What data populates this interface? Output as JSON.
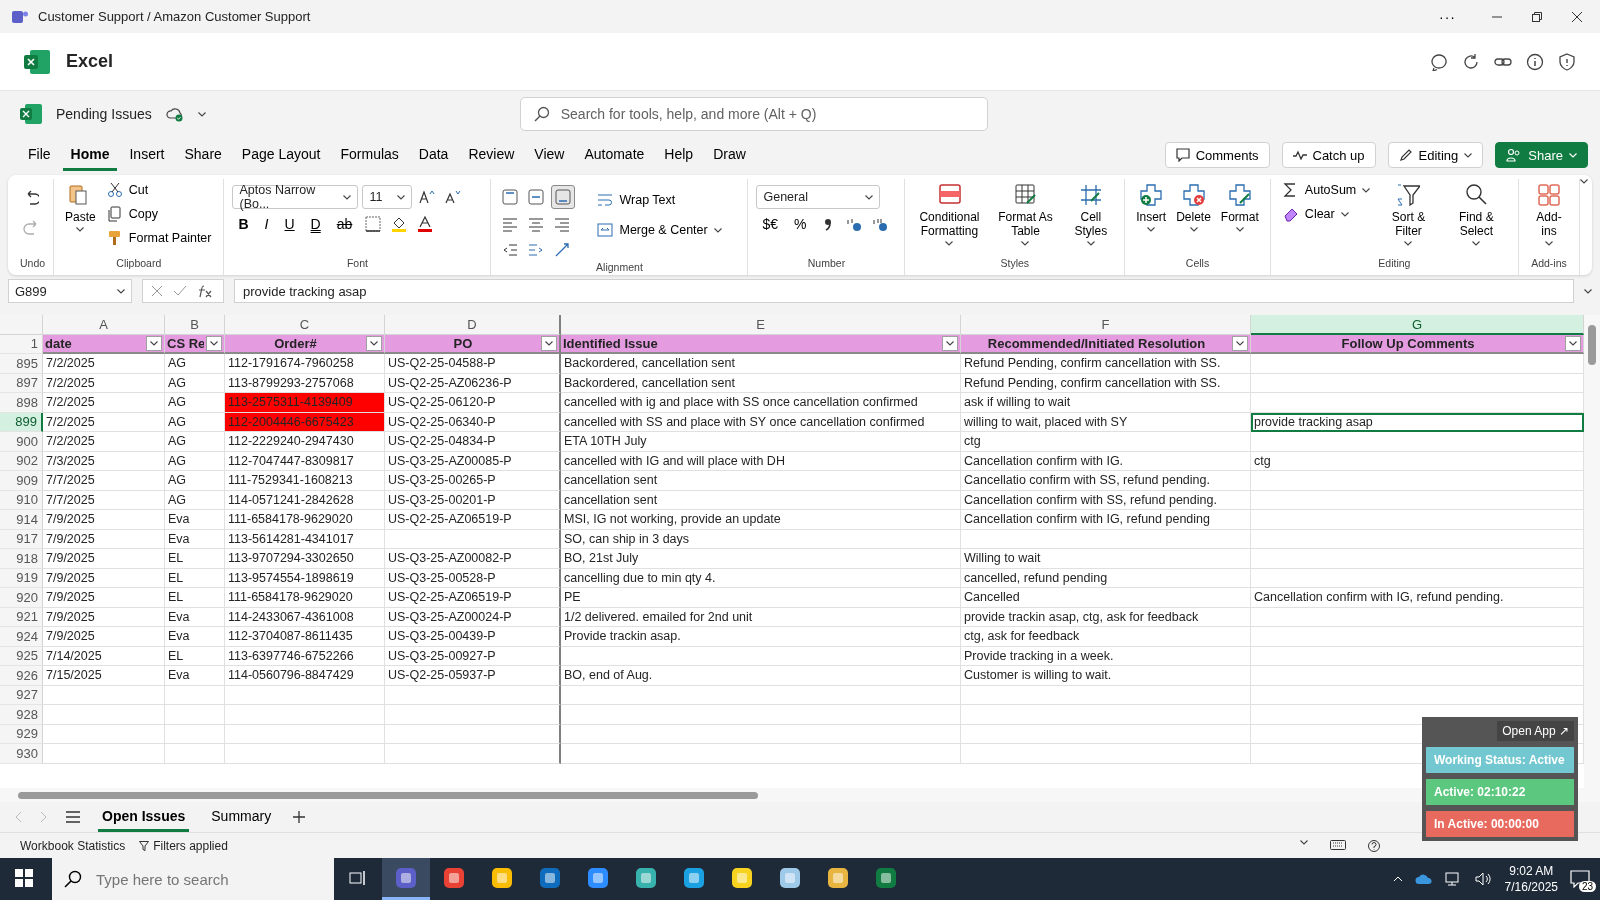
{
  "title_bar": {
    "title": "Customer Support / Amazon Customer Support",
    "more": "···"
  },
  "app_header": {
    "app_name": "Excel"
  },
  "document": {
    "name": "Pending Issues",
    "search": {
      "placeholder": "Search for tools, help, and more (Alt + Q)"
    }
  },
  "menu_tabs": [
    {
      "label": "File",
      "selected": false
    },
    {
      "label": "Home",
      "selected": true
    },
    {
      "label": "Insert",
      "selected": false
    },
    {
      "label": "Share",
      "selected": false
    },
    {
      "label": "Page Layout",
      "selected": false
    },
    {
      "label": "Formulas",
      "selected": false
    },
    {
      "label": "Data",
      "selected": false
    },
    {
      "label": "Review",
      "selected": false
    },
    {
      "label": "View",
      "selected": false
    },
    {
      "label": "Automate",
      "selected": false
    },
    {
      "label": "Help",
      "selected": false
    },
    {
      "label": "Draw",
      "selected": false
    }
  ],
  "header_buttons": [
    {
      "label": "Comments",
      "kind": "plain"
    },
    {
      "label": "Catch up",
      "kind": "plain"
    },
    {
      "label": "Editing",
      "kind": "dropdown"
    },
    {
      "label": "Share",
      "kind": "primary"
    }
  ],
  "ribbon": [
    {
      "label": "Undo",
      "items": [
        {
          "kind": "icon",
          "disabled": false
        },
        {
          "kind": "icon",
          "disabled": true
        }
      ]
    },
    {
      "label": "Clipboard",
      "items": [
        {
          "kind": "large",
          "label": "Paste"
        },
        {
          "kind": "small",
          "label": "Cut"
        },
        {
          "kind": "small",
          "label": "Copy"
        },
        {
          "kind": "small",
          "label": "Format Painter"
        }
      ]
    },
    {
      "label": "Font",
      "items": [
        {
          "kind": "select",
          "value": "Aptos Narrow (Bo..."
        },
        {
          "kind": "select",
          "value": "11"
        },
        {
          "kind": "icon"
        },
        {
          "kind": "icon"
        },
        {
          "kind": "glyph",
          "label": "B"
        },
        {
          "kind": "glyph",
          "label": "I"
        },
        {
          "kind": "glyph",
          "label": "U"
        },
        {
          "kind": "glyph",
          "label": "D"
        },
        {
          "kind": "glyph",
          "label": "ab"
        },
        {
          "kind": "icon"
        },
        {
          "kind": "icon"
        },
        {
          "kind": "icon"
        }
      ]
    },
    {
      "label": "Alignment",
      "items": [
        {
          "kind": "icon",
          "selected": false
        },
        {
          "kind": "icon",
          "selected": false
        },
        {
          "kind": "icon",
          "selected": true
        },
        {
          "kind": "icon",
          "selected": false
        },
        {
          "kind": "icon",
          "selected": false
        },
        {
          "kind": "icon",
          "selected": false
        },
        {
          "kind": "icon",
          "selected": false
        },
        {
          "kind": "icon",
          "selected": false
        },
        {
          "kind": "icon",
          "selected": false
        },
        {
          "kind": "small",
          "label": "Wrap Text"
        },
        {
          "kind": "small",
          "label": "Merge & Center"
        }
      ]
    },
    {
      "label": "Number",
      "items": [
        {
          "kind": "select",
          "value": "General"
        },
        {
          "kind": "glyph",
          "label": "$€"
        },
        {
          "kind": "glyph",
          "label": "%"
        },
        {
          "kind": "icon"
        },
        {
          "kind": "icon"
        },
        {
          "kind": "icon"
        }
      ]
    },
    {
      "label": "Styles",
      "items": [
        {
          "kind": "large",
          "label": "Conditional Formatting"
        },
        {
          "kind": "large",
          "label": "Format As Table"
        },
        {
          "kind": "large",
          "label": "Cell Styles"
        }
      ]
    },
    {
      "label": "Cells",
      "items": [
        {
          "kind": "large",
          "label": "Insert"
        },
        {
          "kind": "large",
          "label": "Delete"
        },
        {
          "kind": "large",
          "label": "Format"
        }
      ]
    },
    {
      "label": "Editing",
      "items": [
        {
          "kind": "small",
          "label": "AutoSum"
        },
        {
          "kind": "small",
          "label": "Clear"
        },
        {
          "kind": "large",
          "label": "Sort & Filter"
        },
        {
          "kind": "large",
          "label": "Find & Select"
        }
      ]
    },
    {
      "label": "Add-ins",
      "items": [
        {
          "kind": "large",
          "label": "Add-ins"
        }
      ]
    }
  ],
  "formula_bar": {
    "name_box": "G899",
    "formula": "provide tracking asap"
  },
  "sheet": {
    "columns": [
      {
        "letter": "A",
        "selected": false
      },
      {
        "letter": "B",
        "selected": false
      },
      {
        "letter": "C",
        "selected": false
      },
      {
        "letter": "D",
        "selected": false
      },
      {
        "letter": "E",
        "selected": false
      },
      {
        "letter": "F",
        "selected": false
      },
      {
        "letter": "G",
        "selected": true
      }
    ],
    "header_row": {
      "number": "1",
      "cells": [
        "date",
        "CS Re",
        "Order#",
        "PO",
        "Identified Issue",
        "Recommended/Initiated Resolution",
        "Follow Up Comments"
      ]
    },
    "rows": [
      {
        "number": "895",
        "selected": false,
        "cells": [
          "7/2/2025",
          "AG",
          "112-1791674-7960258",
          "US-Q2-25-04588-P",
          "Backordered, cancellation sent",
          "Refund Pending, confirm cancellation with SS.",
          ""
        ]
      },
      {
        "number": "897",
        "selected": false,
        "cells": [
          "7/2/2025",
          "AG",
          "113-8799293-2757068",
          "US-Q2-25-AZ06236-P",
          "Backordered, cancellation sent",
          "Refund Pending, confirm cancellation with SS.",
          ""
        ]
      },
      {
        "number": "898",
        "selected": false,
        "cells": [
          "7/2/2025",
          "AG",
          {
            "text": "113-2575311-4139409",
            "color": "#ff0000"
          },
          "US-Q2-25-06120-P",
          "cancelled with ig and place with SS once cancellation confirmed",
          "ask if willing to wait",
          ""
        ]
      },
      {
        "number": "899",
        "selected": true,
        "cells": [
          "7/2/2025",
          "AG",
          {
            "text": "112-2004446-6675423",
            "color": "#ff0000"
          },
          "US-Q2-25-06340-P",
          "cancelled with SS and place with SY once cancellation confirmed",
          "willing to wait, placed with SY",
          {
            "text": "provide tracking asap",
            "active": true
          }
        ]
      },
      {
        "number": "900",
        "selected": false,
        "cells": [
          "7/2/2025",
          "AG",
          "112-2229240-2947430",
          "US-Q2-25-04834-P",
          "ETA 10TH July",
          "ctg",
          ""
        ]
      },
      {
        "number": "902",
        "selected": false,
        "cells": [
          "7/3/2025",
          "AG",
          "112-7047447-8309817",
          "US-Q3-25-AZ00085-P",
          "cancelled with IG and will place with DH",
          "Cancellation confirm with IG.",
          "ctg"
        ]
      },
      {
        "number": "909",
        "selected": false,
        "cells": [
          "7/7/2025",
          "AG",
          "111-7529341-1608213",
          "US-Q3-25-00265-P",
          "cancellation sent",
          "Cancellatio confirm with SS, refund pending.",
          ""
        ]
      },
      {
        "number": "910",
        "selected": false,
        "cells": [
          "7/7/2025",
          "AG",
          "114-0571241-2842628",
          "US-Q3-25-00201-P",
          "cancellation sent",
          "Cancellation confirm with SS, refund pending.",
          ""
        ]
      },
      {
        "number": "914",
        "selected": false,
        "cells": [
          "7/9/2025",
          "Eva",
          "111-6584178-9629020",
          "US-Q2-25-AZ06519-P",
          "MSI, IG not working, provide an update",
          "Cancellation confirm with IG, refund pending",
          ""
        ]
      },
      {
        "number": "917",
        "selected": false,
        "cells": [
          "7/9/2025",
          "Eva",
          "113-5614281-4341017",
          "",
          "SO, can ship in 3 days",
          "",
          ""
        ]
      },
      {
        "number": "918",
        "selected": false,
        "cells": [
          "7/9/2025",
          "EL",
          "113-9707294-3302650",
          "US-Q3-25-AZ00082-P",
          "BO, 21st July",
          "Willing to wait",
          ""
        ]
      },
      {
        "number": "919",
        "selected": false,
        "cells": [
          "7/9/2025",
          "EL",
          "113-9574554-1898619",
          "US-Q3-25-00528-P",
          "cancelling due to min qty 4.",
          "cancelled, refund pending",
          ""
        ]
      },
      {
        "number": "920",
        "selected": false,
        "cells": [
          "7/9/2025",
          "EL",
          "111-6584178-9629020",
          "US-Q2-25-AZ06519-P",
          "PE",
          "Cancelled",
          "Cancellation confirm with IG, refund pending."
        ]
      },
      {
        "number": "921",
        "selected": false,
        "cells": [
          "7/9/2025",
          "Eva",
          "114-2433067-4361008",
          "US-Q3-25-AZ00024-P",
          "1/2 delivered. emailed for 2nd unit",
          "provide trackin asap, ctg, ask for feedback",
          ""
        ]
      },
      {
        "number": "924",
        "selected": false,
        "cells": [
          "7/9/2025",
          "Eva",
          "112-3704087-8611435",
          "US-Q3-25-00439-P",
          "Provide trackin asap.",
          "ctg, ask for feedback",
          ""
        ]
      },
      {
        "number": "925",
        "selected": false,
        "cells": [
          "7/14/2025",
          "EL",
          "113-6397746-6752266",
          "US-Q3-25-00927-P",
          "",
          "Provide tracking in a week.",
          ""
        ]
      },
      {
        "number": "926",
        "selected": false,
        "cells": [
          "7/15/2025",
          "Eva",
          "114-0560796-8847429",
          "US-Q2-25-05937-P",
          "BO, end of Aug.",
          "Customer is willing to wait.",
          ""
        ]
      },
      {
        "number": "927",
        "selected": false,
        "cells": [
          "",
          "",
          "",
          "",
          "",
          "",
          ""
        ]
      },
      {
        "number": "928",
        "selected": false,
        "cells": [
          "",
          "",
          "",
          "",
          "",
          "",
          ""
        ]
      },
      {
        "number": "929",
        "selected": false,
        "cells": [
          "",
          "",
          "",
          "",
          "",
          "",
          ""
        ]
      },
      {
        "number": "930",
        "selected": false,
        "cells": [
          "",
          "",
          "",
          "",
          "",
          "",
          ""
        ]
      }
    ]
  },
  "sheet_tabs": [
    {
      "label": "Open Issues",
      "selected": true
    },
    {
      "label": "Summary",
      "selected": false
    }
  ],
  "status_bar": {
    "items": [
      "Workbook Statistics",
      "Filters applied"
    ]
  },
  "status_widget": {
    "open_app": "Open App ↗",
    "items": [
      {
        "label": "Working Status: Active",
        "color": "#72c7d0"
      },
      {
        "label": "Active: 02:10:22",
        "color": "#5cc77e"
      },
      {
        "label": "In Active: 00:00:00",
        "color": "#e8695e"
      }
    ]
  },
  "taskbar": {
    "search": {
      "placeholder": "Type here to search"
    },
    "apps": [
      {
        "color": "#5b5fc7",
        "selected": true
      },
      {
        "color": "#e94235",
        "selected": false
      },
      {
        "color": "#fbbc04",
        "selected": false
      },
      {
        "color": "#0f6cbd",
        "selected": false
      },
      {
        "color": "#2d8cff",
        "selected": false
      },
      {
        "color": "#38b2ac",
        "selected": false
      },
      {
        "color": "#1ba1e2",
        "selected": false
      },
      {
        "color": "#f7d21e",
        "selected": false
      },
      {
        "color": "#9ec9e8",
        "selected": false
      },
      {
        "color": "#e8b640",
        "selected": false
      },
      {
        "color": "#107c41",
        "selected": false
      }
    ],
    "time": "9:02 AM",
    "date": "7/16/2025",
    "notifications": "23"
  }
}
